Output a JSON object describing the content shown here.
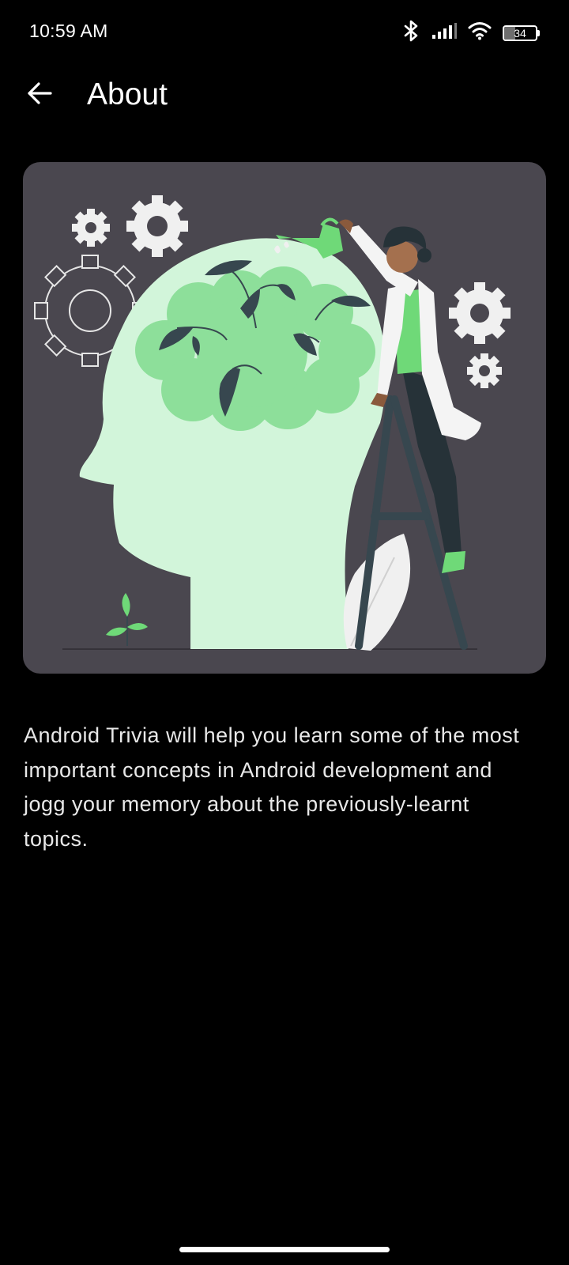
{
  "status_bar": {
    "time": "10:59 AM",
    "battery_level": "34",
    "battery_fraction": 0.34,
    "icons": [
      "bluetooth-icon",
      "signal-icon",
      "wifi-icon",
      "battery-icon"
    ]
  },
  "toolbar": {
    "back_icon": "arrow-left-icon",
    "title": "About"
  },
  "illustration": {
    "subject": "scientist-watering-brain-plants",
    "colors": {
      "card_background": "#4a474f",
      "head": "#d2f5da",
      "brain": "#8ddf9a",
      "accent": "#6fd978",
      "leaf_dark": "#37474f",
      "ladder": "#37474f",
      "gear_light": "#f0f0f0"
    }
  },
  "content": {
    "description": "Android Trivia will help you learn some of the most important concepts in Android development and jogg your memory about the previously-learnt topics."
  }
}
